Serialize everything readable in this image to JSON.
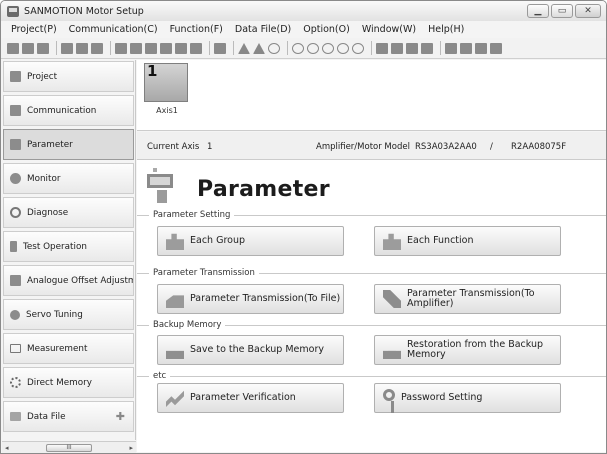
{
  "window": {
    "title": "SANMOTION Motor Setup",
    "controls": [
      "minimize",
      "maximize",
      "close"
    ]
  },
  "menu": [
    "Project(P)",
    "Communication(C)",
    "Function(F)",
    "Data File(D)",
    "Option(O)",
    "Window(W)",
    "Help(H)"
  ],
  "sidebar": {
    "items": [
      {
        "label": "Project",
        "icon": "project-icon"
      },
      {
        "label": "Communication",
        "icon": "communication-icon"
      },
      {
        "label": "Parameter",
        "icon": "parameter-icon",
        "active": true
      },
      {
        "label": "Monitor",
        "icon": "monitor-icon"
      },
      {
        "label": "Diagnose",
        "icon": "diagnose-icon"
      },
      {
        "label": "Test Operation",
        "icon": "test-operation-icon"
      },
      {
        "label": "Analogue Offset Adjustmen",
        "icon": "analogue-offset-icon"
      },
      {
        "label": "Servo Tuning",
        "icon": "servo-tuning-icon"
      },
      {
        "label": "Measurement",
        "icon": "measurement-icon"
      },
      {
        "label": "Direct Memory",
        "icon": "direct-memory-icon"
      },
      {
        "label": "Data File",
        "icon": "data-file-icon"
      }
    ],
    "data_file_add": "✚"
  },
  "axis": {
    "number": "1",
    "name": "Axis1"
  },
  "info": {
    "current_axis_label": "Current Axis",
    "current_axis_value": "1",
    "model_label": "Amplifier/Motor Model",
    "amplifier_model": "RS3A03A2AA0",
    "separator": "/",
    "motor_model": "R2AA08075F"
  },
  "page_title": "Parameter",
  "groups": {
    "parameter_setting": "Parameter Setting",
    "parameter_transmission": "Parameter Transmission",
    "backup_memory": "Backup Memory",
    "etc": "etc"
  },
  "buttons": {
    "each_group": "Each Group",
    "each_function": "Each Function",
    "transmission_to_file": "Parameter Transmission(To File)",
    "transmission_to_amplifier_1": "Parameter Transmission(To",
    "transmission_to_amplifier_2": "Amplifier)",
    "save_backup": "Save to the Backup Memory",
    "restore_backup_1": "Restoration from the Backup",
    "restore_backup_2": "Memory",
    "parameter_verification": "Parameter Verification",
    "password_setting": "Password Setting"
  },
  "scrollbar": {
    "left": "◂",
    "thumb": "III",
    "right": "▸"
  }
}
